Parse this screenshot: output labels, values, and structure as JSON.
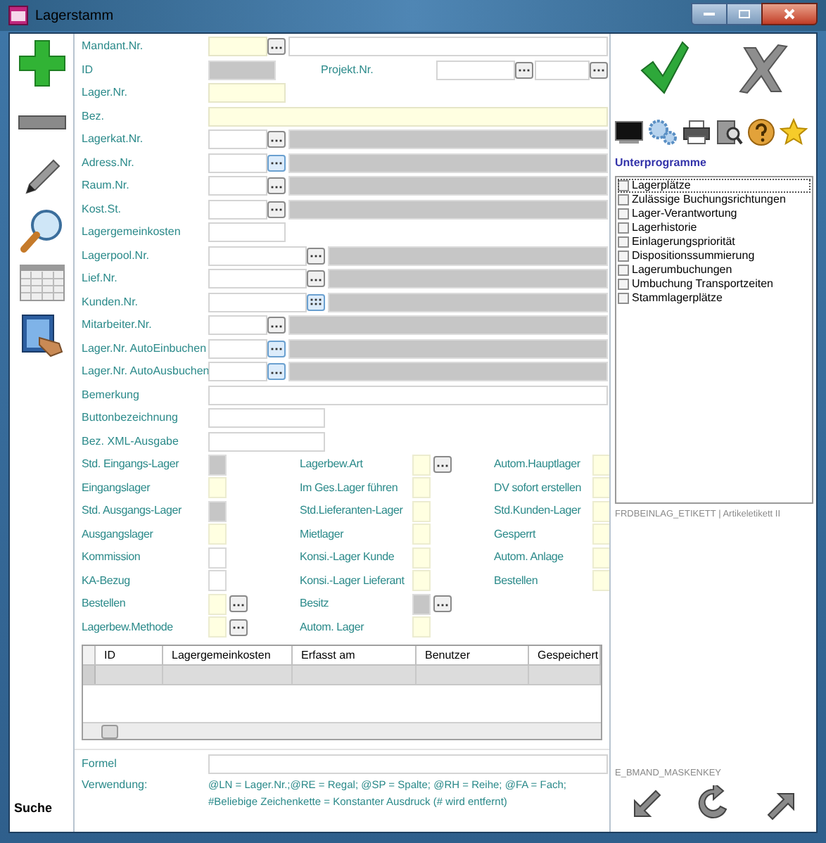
{
  "window": {
    "title": "Lagerstamm"
  },
  "toolbar": {
    "search_label": "Suche"
  },
  "fields": [
    {
      "kind": "mandant",
      "label": "Mandant.Nr.",
      "required": true
    },
    {
      "kind": "id",
      "label": "ID",
      "extra_label": "Projekt.Nr."
    },
    {
      "kind": "text_short",
      "label": "Lager.Nr.",
      "required": true
    },
    {
      "kind": "text_wide",
      "label": "Bez.",
      "required": true
    },
    {
      "kind": "lookup",
      "label": "Lagerkat.Nr.",
      "highlighted": false
    },
    {
      "kind": "lookup",
      "label": "Adress.Nr.",
      "highlighted": true
    },
    {
      "kind": "lookup",
      "label": "Raum.Nr.",
      "highlighted": false
    },
    {
      "kind": "lookup",
      "label": "Kost.St.",
      "highlighted": false
    },
    {
      "kind": "text_short",
      "label": "Lagergemeinkosten",
      "required": false
    },
    {
      "kind": "lookup_long",
      "label": "Lagerpool.Nr.",
      "highlighted": false
    },
    {
      "kind": "lookup_long",
      "label": "Lief.Nr.",
      "highlighted": false
    },
    {
      "kind": "lookup_grid",
      "label": "Kunden.Nr.",
      "highlighted": true
    },
    {
      "kind": "lookup",
      "label": "Mitarbeiter.Nr.",
      "highlighted": false
    },
    {
      "kind": "lookup",
      "label": "Lager.Nr. AutoEinbuchen",
      "highlighted": true
    },
    {
      "kind": "lookup",
      "label": "Lager.Nr. AutoAusbuchen",
      "highlighted": true
    },
    {
      "kind": "text_wide",
      "label": "Bemerkung",
      "required": false
    },
    {
      "kind": "text_medium",
      "label": "Buttonbezeichnung",
      "required": false
    },
    {
      "kind": "text_medium",
      "label": "Bez. XML-Ausgabe",
      "required": false
    }
  ],
  "flag_columns": [
    [
      {
        "label": "Std. Eingangs-Lager",
        "disabled": true,
        "has_button": false
      },
      {
        "label": "Eingangslager",
        "required": true,
        "disabled": false,
        "has_button": false
      },
      {
        "label": "Std. Ausgangs-Lager",
        "disabled": true,
        "has_button": false
      },
      {
        "label": "Ausgangslager",
        "required": true,
        "disabled": false,
        "has_button": false
      },
      {
        "label": "Kommission",
        "required": false,
        "disabled": false,
        "has_button": false
      },
      {
        "label": "KA-Bezug",
        "required": false,
        "disabled": false,
        "has_button": false
      },
      {
        "label": "Bestellen",
        "required": true,
        "disabled": false,
        "has_button": true
      },
      {
        "label": "Lagerbew.Methode",
        "required": true,
        "disabled": false,
        "has_button": true
      }
    ],
    [
      {
        "label": "Lagerbew.Art",
        "required": true,
        "disabled": false,
        "has_button": true
      },
      {
        "label": "Im Ges.Lager führen",
        "required": true,
        "disabled": false,
        "has_button": false
      },
      {
        "label": "Std.Lieferanten-Lager",
        "required": true,
        "disabled": false,
        "has_button": false
      },
      {
        "label": "Mietlager",
        "required": true,
        "disabled": false,
        "has_button": false
      },
      {
        "label": "Konsi.-Lager Kunde",
        "required": true,
        "disabled": false,
        "has_button": false
      },
      {
        "label": "Konsi.-Lager Lieferant",
        "required": true,
        "disabled": false,
        "has_button": false
      },
      {
        "label": "Besitz",
        "disabled": true,
        "has_button": true
      },
      {
        "label": "Autom. Lager",
        "required": true,
        "disabled": false,
        "has_button": false
      }
    ],
    [
      {
        "label": "Autom.Hauptlager",
        "required": true,
        "disabled": false,
        "has_button": false
      },
      {
        "label": "DV sofort erstellen",
        "required": true,
        "disabled": false,
        "has_button": false
      },
      {
        "label": "Std.Kunden-Lager",
        "required": true,
        "disabled": false,
        "has_button": false
      },
      {
        "label": "Gesperrt",
        "required": true,
        "disabled": false,
        "has_button": false
      },
      {
        "label": "Autom. Anlage",
        "required": true,
        "disabled": false,
        "has_button": false
      },
      {
        "label": "Bestellen",
        "required": true,
        "disabled": false,
        "has_button": false
      }
    ]
  ],
  "table": {
    "columns": [
      "ID",
      "Lagergemeinkosten",
      "Erfasst am",
      "Benutzer",
      "Gespeichert"
    ]
  },
  "formula": {
    "label": "Formel"
  },
  "usage": {
    "label": "Verwendung:",
    "lines": [
      "@LN = Lager.Nr.;@RE = Regal; @SP = Spalte; @RH = Reihe; @FA = Fach;",
      "#Beliebige Zeichenkette = Konstanter Ausdruck (# wird entfernt)"
    ]
  },
  "subprograms": {
    "title": "Unterprogramme",
    "items": [
      {
        "label": "Lagerplätze",
        "checked": false,
        "selected": true
      },
      {
        "label": "Zulässige Buchungsrichtungen",
        "checked": false,
        "selected": false
      },
      {
        "label": "Lager-Verantwortung",
        "checked": false,
        "selected": false
      },
      {
        "label": "Lagerhistorie",
        "checked": false,
        "selected": false
      },
      {
        "label": "Einlagerungspriorität",
        "checked": false,
        "selected": false
      },
      {
        "label": "Dispositionssummierung",
        "checked": false,
        "selected": false
      },
      {
        "label": "Lagerumbuchungen",
        "checked": false,
        "selected": false
      },
      {
        "label": "Umbuchung Transportzeiten",
        "checked": false,
        "selected": false
      },
      {
        "label": "Stammlagerplätze",
        "checked": false,
        "selected": false
      }
    ]
  },
  "label_info": "FRDBEINLAG_ETIKETT | Artikeletikett II",
  "mask_key": "E_BMAND_MASKENKEY"
}
